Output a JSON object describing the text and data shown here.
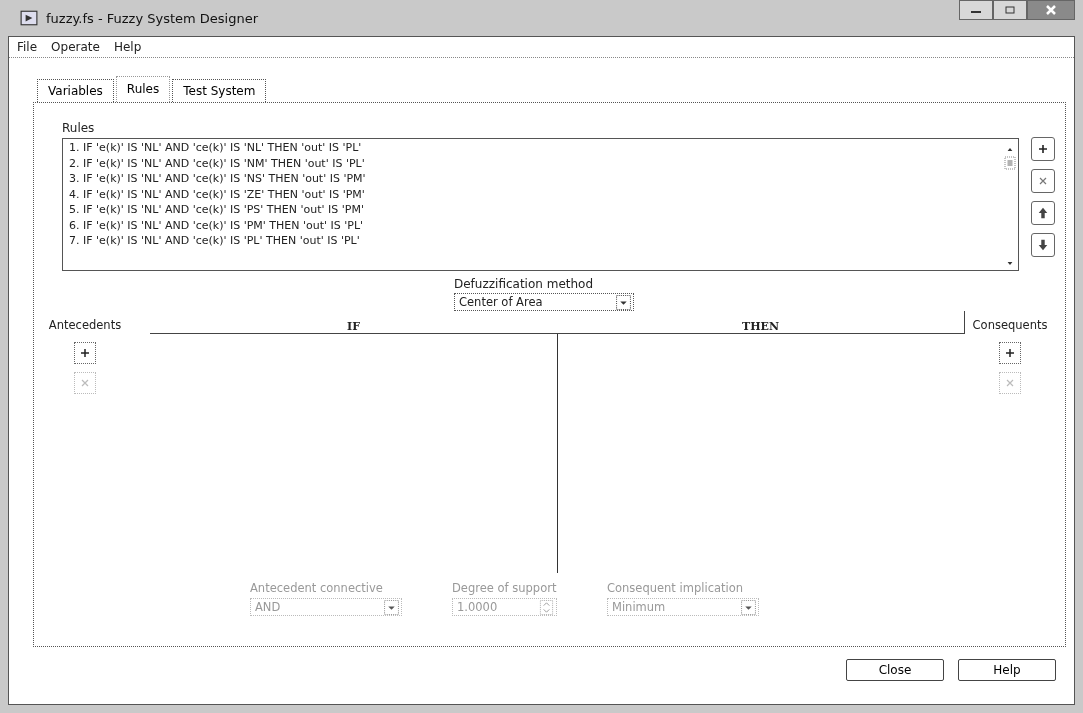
{
  "window": {
    "title": "fuzzy.fs - Fuzzy System Designer"
  },
  "menu": [
    "File",
    "Operate",
    "Help"
  ],
  "tabs": [
    {
      "label": "Variables",
      "selected": false
    },
    {
      "label": "Rules",
      "selected": true
    },
    {
      "label": "Test System",
      "selected": false
    }
  ],
  "rules": {
    "label": "Rules",
    "items": [
      "1. IF 'e(k)' IS 'NL' AND 'ce(k)' IS 'NL' THEN 'out' IS 'PL'",
      "2. IF 'e(k)' IS 'NL' AND 'ce(k)' IS 'NM' THEN 'out' IS 'PL'",
      "3. IF 'e(k)' IS 'NL' AND 'ce(k)' IS 'NS' THEN 'out' IS 'PM'",
      "4. IF 'e(k)' IS 'NL' AND 'ce(k)' IS 'ZE' THEN 'out' IS 'PM'",
      "5. IF 'e(k)' IS 'NL' AND 'ce(k)' IS 'PS' THEN 'out' IS 'PM'",
      "6. IF 'e(k)' IS 'NL' AND 'ce(k)' IS 'PM' THEN 'out' IS 'PL'",
      "7. IF 'e(k)' IS 'NL' AND 'ce(k)' IS 'PL' THEN 'out' IS 'PL'"
    ]
  },
  "defuzzification": {
    "label": "Defuzzification method",
    "value": "Center of Area"
  },
  "antecedents": {
    "label": "Antecedents",
    "add_disabled": false,
    "remove_disabled": true
  },
  "consequents": {
    "label": "Consequents",
    "add_disabled": false,
    "remove_disabled": true
  },
  "editor": {
    "if_label": "IF",
    "then_label": "THEN"
  },
  "bottom_fields": [
    {
      "label": "Antecedent connective",
      "value": "AND",
      "kind": "dropdown",
      "disabled": true
    },
    {
      "label": "Degree of support",
      "value": "1.0000",
      "kind": "spinner",
      "disabled": true
    },
    {
      "label": "Consequent implication",
      "value": "Minimum",
      "kind": "dropdown",
      "disabled": true
    }
  ],
  "buttons": [
    "Close",
    "Help"
  ]
}
